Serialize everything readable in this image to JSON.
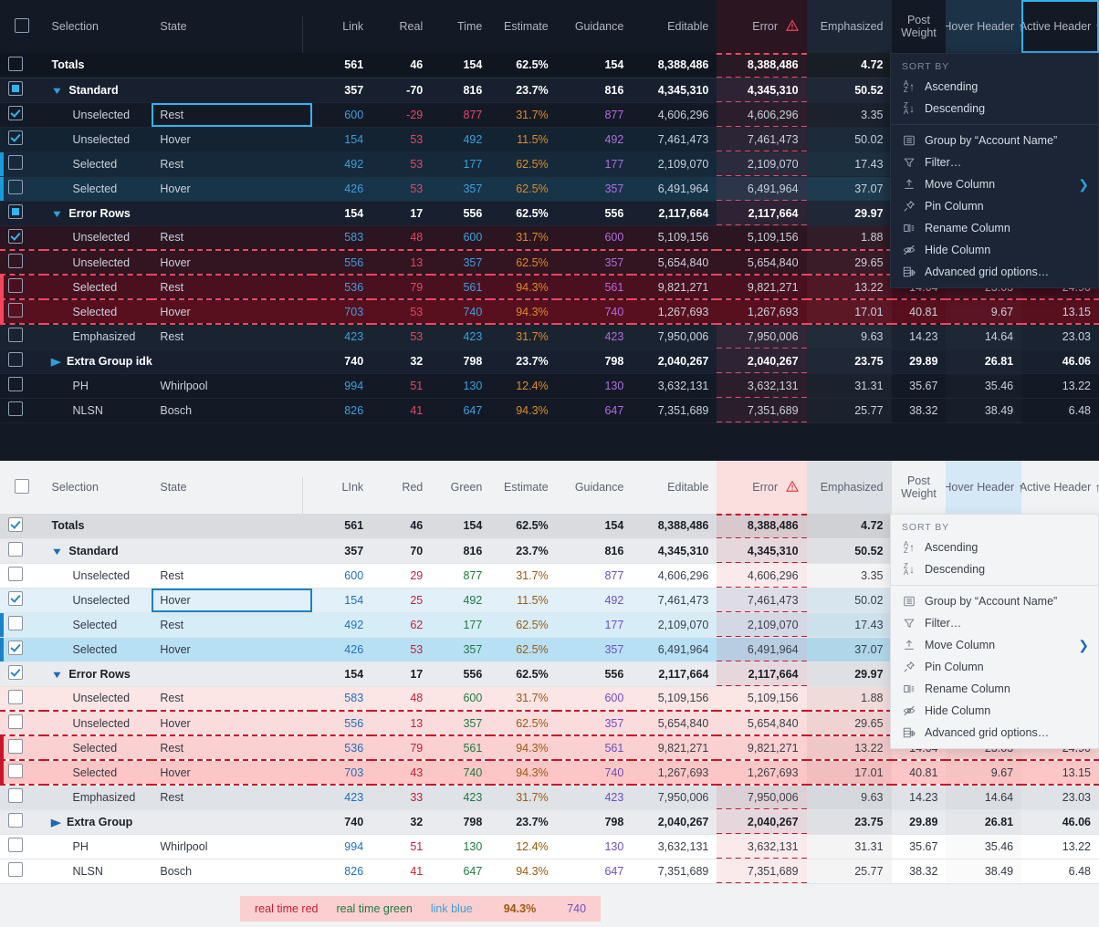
{
  "dark": {
    "headers": {
      "selection": "Selection",
      "state": "State",
      "link": "Link",
      "c2": "Real",
      "c3": "Time",
      "estimate": "Estimate",
      "guidance": "Guidance",
      "editable": "Editable",
      "error": "Error",
      "emphasized": "Emphasized",
      "post_weight": "Post Weight",
      "hover_header": "Hover Header",
      "active_header": "Active Header"
    },
    "rows": [
      {
        "label": "Totals",
        "state": "",
        "link": "561",
        "c2": "46",
        "c3": "154",
        "estimate": "62.5%",
        "guidance": "154",
        "editable": "8,388,486",
        "error": "8,388,486",
        "emphasized": "4.72",
        "pw": "",
        "hh": "",
        "ah": ""
      },
      {
        "label": "Standard",
        "state": "",
        "link": "357",
        "c2": "-70",
        "c3": "816",
        "estimate": "23.7%",
        "guidance": "816",
        "editable": "4,345,310",
        "error": "4,345,310",
        "emphasized": "50.52",
        "pw": "",
        "hh": "",
        "ah": ""
      },
      {
        "label": "Unselected",
        "state": "Rest",
        "link": "600",
        "c2": "-29",
        "c3": "877",
        "estimate": "31.7%",
        "guidance": "877",
        "editable": "4,606,296",
        "error": "4,606,296",
        "emphasized": "3.35",
        "pw": "",
        "hh": "",
        "ah": ""
      },
      {
        "label": "Unselected",
        "state": "Hover",
        "link": "154",
        "c2": "53",
        "c3": "492",
        "estimate": "11.5%",
        "guidance": "492",
        "editable": "7,461,473",
        "error": "7,461,473",
        "emphasized": "50.02",
        "pw": "",
        "hh": "",
        "ah": ""
      },
      {
        "label": "Selected",
        "state": "Rest",
        "link": "492",
        "c2": "53",
        "c3": "177",
        "estimate": "62.5%",
        "guidance": "177",
        "editable": "2,109,070",
        "error": "2,109,070",
        "emphasized": "17.43",
        "pw": "",
        "hh": "",
        "ah": ""
      },
      {
        "label": "Selected",
        "state": "Hover",
        "link": "426",
        "c2": "53",
        "c3": "357",
        "estimate": "62.5%",
        "guidance": "357",
        "editable": "6,491,964",
        "error": "6,491,964",
        "emphasized": "37.07",
        "pw": "",
        "hh": "",
        "ah": ""
      },
      {
        "label": "Error Rows",
        "state": "",
        "link": "154",
        "c2": "17",
        "c3": "556",
        "estimate": "62.5%",
        "guidance": "556",
        "editable": "2,117,664",
        "error": "2,117,664",
        "emphasized": "29.97",
        "pw": "",
        "hh": "",
        "ah": ""
      },
      {
        "label": "Unselected",
        "state": "Rest",
        "link": "583",
        "c2": "48",
        "c3": "600",
        "estimate": "31.7%",
        "guidance": "600",
        "editable": "5,109,156",
        "error": "5,109,156",
        "emphasized": "1.88",
        "pw": "",
        "hh": "",
        "ah": ""
      },
      {
        "label": "Unselected",
        "state": "Hover",
        "link": "556",
        "c2": "13",
        "c3": "357",
        "estimate": "62.5%",
        "guidance": "357",
        "editable": "5,654,840",
        "error": "5,654,840",
        "emphasized": "29.65",
        "pw": "",
        "hh": "",
        "ah": ""
      },
      {
        "label": "Selected",
        "state": "Rest",
        "link": "536",
        "c2": "79",
        "c3": "561",
        "estimate": "94.3%",
        "guidance": "561",
        "editable": "9,821,271",
        "error": "9,821,271",
        "emphasized": "13.22",
        "pw": "14.64",
        "hh": "23.03",
        "ah": "24.90"
      },
      {
        "label": "Selected",
        "state": "Hover",
        "link": "703",
        "c2": "53",
        "c3": "740",
        "estimate": "94.3%",
        "guidance": "740",
        "editable": "1,267,693",
        "error": "1,267,693",
        "emphasized": "17.01",
        "pw": "40.81",
        "hh": "9.67",
        "ah": "13.15"
      },
      {
        "label": "Emphasized",
        "state": "Rest",
        "link": "423",
        "c2": "53",
        "c3": "423",
        "estimate": "31.7%",
        "guidance": "423",
        "editable": "7,950,006",
        "error": "7,950,006",
        "emphasized": "9.63",
        "pw": "14.23",
        "hh": "14.64",
        "ah": "23.03"
      },
      {
        "label": "Extra Group idk",
        "state": "",
        "link": "740",
        "c2": "32",
        "c3": "798",
        "estimate": "23.7%",
        "guidance": "798",
        "editable": "2,040,267",
        "error": "2,040,267",
        "emphasized": "23.75",
        "pw": "29.89",
        "hh": "26.81",
        "ah": "46.06"
      },
      {
        "label": "PH",
        "state": "Whirlpool",
        "link": "994",
        "c2": "51",
        "c3": "130",
        "estimate": "12.4%",
        "guidance": "130",
        "editable": "3,632,131",
        "error": "3,632,131",
        "emphasized": "31.31",
        "pw": "35.67",
        "hh": "35.46",
        "ah": "13.22"
      },
      {
        "label": "NLSN",
        "state": "Bosch",
        "link": "826",
        "c2": "41",
        "c3": "647",
        "estimate": "94.3%",
        "guidance": "647",
        "editable": "7,351,689",
        "error": "7,351,689",
        "emphasized": "25.77",
        "pw": "38.32",
        "hh": "38.49",
        "ah": "6.48"
      }
    ]
  },
  "light": {
    "headers": {
      "selection": "Selection",
      "state": "State",
      "link": "LInk",
      "c2": "Red",
      "c3": "Green",
      "estimate": "Estimate",
      "guidance": "Guidance",
      "editable": "Editable",
      "error": "Error",
      "emphasized": "Emphasized",
      "post_weight": "Post Weight",
      "hover_header": "Hover Header",
      "active_header": "Active Header"
    },
    "rows": [
      {
        "label": "Totals",
        "state": "",
        "link": "561",
        "c2": "46",
        "c3": "154",
        "estimate": "62.5%",
        "guidance": "154",
        "editable": "8,388,486",
        "error": "8,388,486",
        "emphasized": "4.72",
        "pw": "",
        "hh": "",
        "ah": ""
      },
      {
        "label": "Standard",
        "state": "",
        "link": "357",
        "c2": "70",
        "c3": "816",
        "estimate": "23.7%",
        "guidance": "816",
        "editable": "4,345,310",
        "error": "4,345,310",
        "emphasized": "50.52",
        "pw": "",
        "hh": "",
        "ah": ""
      },
      {
        "label": "Unselected",
        "state": "Rest",
        "link": "600",
        "c2": "29",
        "c3": "877",
        "estimate": "31.7%",
        "guidance": "877",
        "editable": "4,606,296",
        "error": "4,606,296",
        "emphasized": "3.35",
        "pw": "",
        "hh": "",
        "ah": ""
      },
      {
        "label": "Unselected",
        "state": "Hover",
        "link": "154",
        "c2": "25",
        "c3": "492",
        "estimate": "11.5%",
        "guidance": "492",
        "editable": "7,461,473",
        "error": "7,461,473",
        "emphasized": "50.02",
        "pw": "",
        "hh": "",
        "ah": ""
      },
      {
        "label": "Selected",
        "state": "Rest",
        "link": "492",
        "c2": "62",
        "c3": "177",
        "estimate": "62.5%",
        "guidance": "177",
        "editable": "2,109,070",
        "error": "2,109,070",
        "emphasized": "17.43",
        "pw": "",
        "hh": "",
        "ah": ""
      },
      {
        "label": "Selected",
        "state": "Hover",
        "link": "426",
        "c2": "53",
        "c3": "357",
        "estimate": "62.5%",
        "guidance": "357",
        "editable": "6,491,964",
        "error": "6,491,964",
        "emphasized": "37.07",
        "pw": "",
        "hh": "",
        "ah": ""
      },
      {
        "label": "Error Rows",
        "state": "",
        "link": "154",
        "c2": "17",
        "c3": "556",
        "estimate": "62.5%",
        "guidance": "556",
        "editable": "2,117,664",
        "error": "2,117,664",
        "emphasized": "29.97",
        "pw": "",
        "hh": "",
        "ah": ""
      },
      {
        "label": "Unselected",
        "state": "Rest",
        "link": "583",
        "c2": "48",
        "c3": "600",
        "estimate": "31.7%",
        "guidance": "600",
        "editable": "5,109,156",
        "error": "5,109,156",
        "emphasized": "1.88",
        "pw": "",
        "hh": "",
        "ah": ""
      },
      {
        "label": "Unselected",
        "state": "Hover",
        "link": "556",
        "c2": "13",
        "c3": "357",
        "estimate": "62.5%",
        "guidance": "357",
        "editable": "5,654,840",
        "error": "5,654,840",
        "emphasized": "29.65",
        "pw": "",
        "hh": "",
        "ah": ""
      },
      {
        "label": "Selected",
        "state": "Rest",
        "link": "536",
        "c2": "79",
        "c3": "561",
        "estimate": "94.3%",
        "guidance": "561",
        "editable": "9,821,271",
        "error": "9,821,271",
        "emphasized": "13.22",
        "pw": "14.64",
        "hh": "23.03",
        "ah": "24.90"
      },
      {
        "label": "Selected",
        "state": "Hover",
        "link": "703",
        "c2": "43",
        "c3": "740",
        "estimate": "94.3%",
        "guidance": "740",
        "editable": "1,267,693",
        "error": "1,267,693",
        "emphasized": "17.01",
        "pw": "40.81",
        "hh": "9.67",
        "ah": "13.15"
      },
      {
        "label": "Emphasized",
        "state": "Rest",
        "link": "423",
        "c2": "33",
        "c3": "423",
        "estimate": "31.7%",
        "guidance": "423",
        "editable": "7,950,006",
        "error": "7,950,006",
        "emphasized": "9.63",
        "pw": "14.23",
        "hh": "14.64",
        "ah": "23.03"
      },
      {
        "label": "Extra Group",
        "state": "",
        "link": "740",
        "c2": "32",
        "c3": "798",
        "estimate": "23.7%",
        "guidance": "798",
        "editable": "2,040,267",
        "error": "2,040,267",
        "emphasized": "23.75",
        "pw": "29.89",
        "hh": "26.81",
        "ah": "46.06"
      },
      {
        "label": "PH",
        "state": "Whirlpool",
        "link": "994",
        "c2": "51",
        "c3": "130",
        "estimate": "12.4%",
        "guidance": "130",
        "editable": "3,632,131",
        "error": "3,632,131",
        "emphasized": "31.31",
        "pw": "35.67",
        "hh": "35.46",
        "ah": "13.22"
      },
      {
        "label": "NLSN",
        "state": "Bosch",
        "link": "826",
        "c2": "41",
        "c3": "647",
        "estimate": "94.3%",
        "guidance": "647",
        "editable": "7,351,689",
        "error": "7,351,689",
        "emphasized": "25.77",
        "pw": "38.32",
        "hh": "38.49",
        "ah": "6.48"
      }
    ]
  },
  "menu": {
    "section_label": "SORT BY",
    "ascending": "Ascending",
    "descending": "Descending",
    "group_by": "Group by “Account Name”",
    "filter": "Filter…",
    "move_column": "Move Column",
    "pin_column": "Pin Column",
    "rename_column": "Rename Column",
    "hide_column": "Hide Column",
    "advanced": "Advanced grid options…"
  },
  "legend": {
    "red": "real time red",
    "green": "real time green",
    "blue": "link blue",
    "estimate": "94.3%",
    "guidance": "740"
  },
  "colors": {
    "accent_blue": "#34b3f1",
    "error_red": "#f4465f",
    "link_blue_dark": "#3aa0e0",
    "link_blue_light": "#1d6fc0",
    "green_light": "#1f7a42",
    "red_light": "#c21f36",
    "estimate_orange_dark": "#e08a22",
    "estimate_brown_light": "#9a5a10",
    "guidance_purple_dark": "#b36ae0",
    "guidance_purple_light": "#6b4fc9",
    "dark_bg": "#131a26",
    "light_bg": "#f1f2f4"
  }
}
